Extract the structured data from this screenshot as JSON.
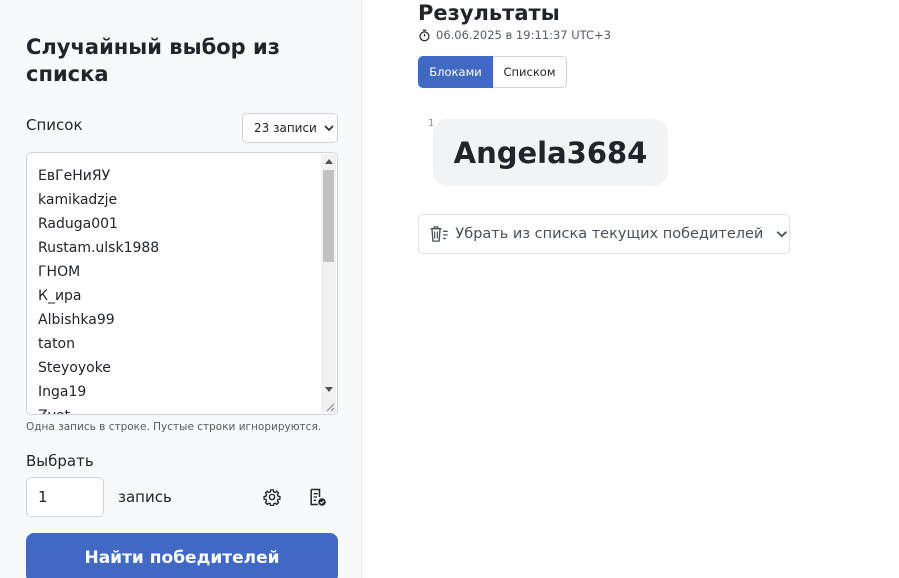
{
  "left_panel": {
    "title": "Случайный выбор из списка",
    "list_label": "Список",
    "records_dropdown": "23 записи",
    "items": [
      "ЕвГеНиЯУ",
      "kamikadzje",
      "Raduga001",
      "Rustam.ulsk1988",
      "ГНОМ",
      "К_ира",
      "Albishka99",
      "taton",
      "Steyoyoke",
      "Inga19",
      "Zvet"
    ],
    "hint": "Одна запись в строке. Пустые строки игнорируются.",
    "choose_label": "Выбрать",
    "count_value": "1",
    "unit_label": "запись",
    "find_button": "Найти победителей"
  },
  "results": {
    "title": "Результаты",
    "timestamp": "06.06.2025 в 19:11:37 UTC+3",
    "view_blocks": "Блоками",
    "view_list": "Списком",
    "winner_index": "1",
    "winner_name": "Angela3684",
    "remove_button": "Убрать из списка текущих победителей"
  },
  "colors": {
    "primary": "#4169c4",
    "card_bg": "#f8f9fa",
    "winner_bg": "#f1f3f5"
  }
}
